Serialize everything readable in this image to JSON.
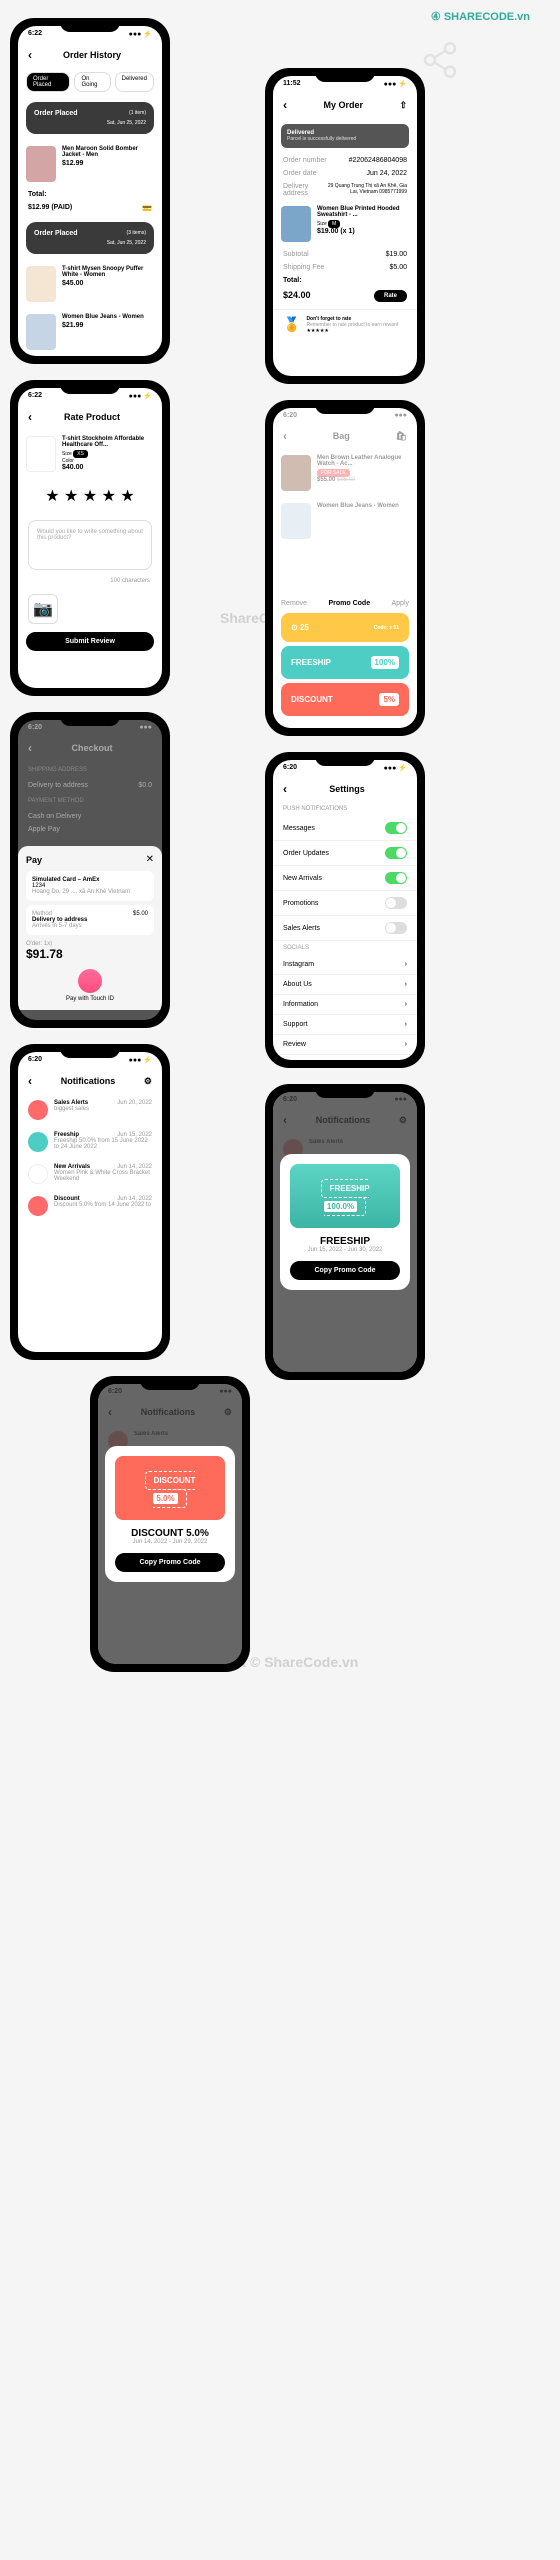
{
  "logo": "SHARECODE.vn",
  "wm1": "ShareCode.vn",
  "wm2": "Copyright © ShareCode.vn",
  "s1": {
    "time": "6:22",
    "title": "Order History",
    "tabs": [
      "Order Placed",
      "On Going",
      "Delivered"
    ],
    "card1": "Order Placed",
    "card1sub": "Sat, Jun 25, 2022",
    "card1badge": "(1 item)",
    "p1": "Men Maroon Solid Bomber Jacket - Men",
    "p1p": "$12.99",
    "total": "Total:",
    "totalv": "$12.99 (PAID)",
    "card2": "Order Placed",
    "card2badge": "(3 items)",
    "card2sub": "Sat, Jun 25, 2022",
    "p2": "T-shirt Mysen Snoopy Puffer White - Women",
    "p2p": "$45.00",
    "p3": "Women Blue Jeans - Women",
    "p3p": "$21.99"
  },
  "s2": {
    "time": "11:52",
    "title": "My Order",
    "status": "Delivered",
    "statusd": "Parcel is successfully delivered",
    "on": "Order number",
    "onv": "#22062486804098",
    "od": "Order date",
    "odv": "Jun 24, 2022",
    "da": "Delivery address",
    "dav": "29 Quang Trung Thị xã An Khê, Gia Lai, Vietnam 0985771999",
    "pn": "Women Blue Printed Hooded Sweatshirt - ...",
    "size": "Size",
    "sizev": "M",
    "price": "$19.00 (x 1)",
    "sub": "Subtotal",
    "subv": "$19.00",
    "ship": "Shipping Fee",
    "shipv": "$5.00",
    "tot": "Total:",
    "totv": "$24.00",
    "rate": "Rate",
    "remind": "Don't forget to rate",
    "remindd": "Remember to rate product to earn reward"
  },
  "s3": {
    "time": "6:22",
    "title": "Rate Product",
    "pn": "T-shirt Stockholm Affordable Healthcare Off...",
    "size": "Size",
    "sizev": "XS",
    "color": "Color",
    "price": "$40.00",
    "ph": "Would you like to write something about this product?",
    "chars": "100 characters",
    "submit": "Submit Review"
  },
  "s4": {
    "title": "Bag",
    "p1": "Men Brown Leather Analogue Watch - Ac...",
    "p1p": "$55.00",
    "p1old": "$95.00",
    "sale": "FOR SALE",
    "p2": "Women Blue Jeans - Women",
    "remove": "Remove",
    "promo": "Promo Code",
    "apply": "Apply",
    "c1": "25",
    "c1s": "Code: x 51",
    "c2": "FREESHIP",
    "c2v": "100%",
    "c3": "DISCOUNT",
    "c3v": "5%"
  },
  "s5": {
    "title": "Checkout",
    "ship": "SHIPPING ADDRESS",
    "del": "Delivery to address",
    "delv": "$0.0",
    "pay": "PAYMENT METHOD",
    "cod": "Cash on Delivery",
    "ap": "Apple Pay",
    "apple": "Pay",
    "card": "Simulated Card – AmEx",
    "cardn": "1234",
    "cardd": "Hoang Do, 29 ..., xã An Khê Vietnam",
    "method": "Method",
    "del2": "Delivery to address",
    "del2d": "Arrives in 5-7 days",
    "del2v": "$5.00",
    "ord": "O'der: 1x)",
    "total": "$91.78",
    "touch": "Pay with Touch ID"
  },
  "s6": {
    "time": "6:20",
    "title": "Settings",
    "sect1": "PUSH NOTIFICATIONS",
    "i1": "Messages",
    "i2": "Order Updates",
    "i3": "New Arrivals",
    "i4": "Promotions",
    "i5": "Sales Alerts",
    "sect2": "SOCIALS",
    "i6": "Instagram",
    "i7": "About Us",
    "i8": "Information",
    "i9": "Support",
    "i10": "Review"
  },
  "s7": {
    "time": "6:20",
    "title": "Notifications",
    "n1": "Sales Alerts",
    "n1d": "biggest sales",
    "n1t": "Jun 20, 2022",
    "n2": "Freeship",
    "n2d": "Freeship 50.0% from 15 June 2022 to 24 June 2022",
    "n2t": "Jun 15, 2022",
    "n3": "New Arrivals",
    "n3d": "Women Pink & White Cross Bracket Weekend",
    "n3t": "Jun 14, 2022",
    "n4": "Discount",
    "n4d": "Discount 5.0% from 14 June 2022 to",
    "n4t": "Jun 14, 2022"
  },
  "s8": {
    "time": "6:20",
    "title": "Notifications",
    "badge": "FREESHIP",
    "badgev": "100.0%",
    "name": "FREESHIP",
    "dates": "Jun 15, 2022 - Jun 30, 2022",
    "btn": "Copy Promo Code"
  },
  "s9": {
    "time": "6:20",
    "title": "Notifications",
    "badge": "DISCOUNT",
    "badgev": "5.0%",
    "name": "DISCOUNT 5.0%",
    "dates": "Jun 14, 2022 - Jun 29, 2022",
    "btn": "Copy Promo Code"
  }
}
